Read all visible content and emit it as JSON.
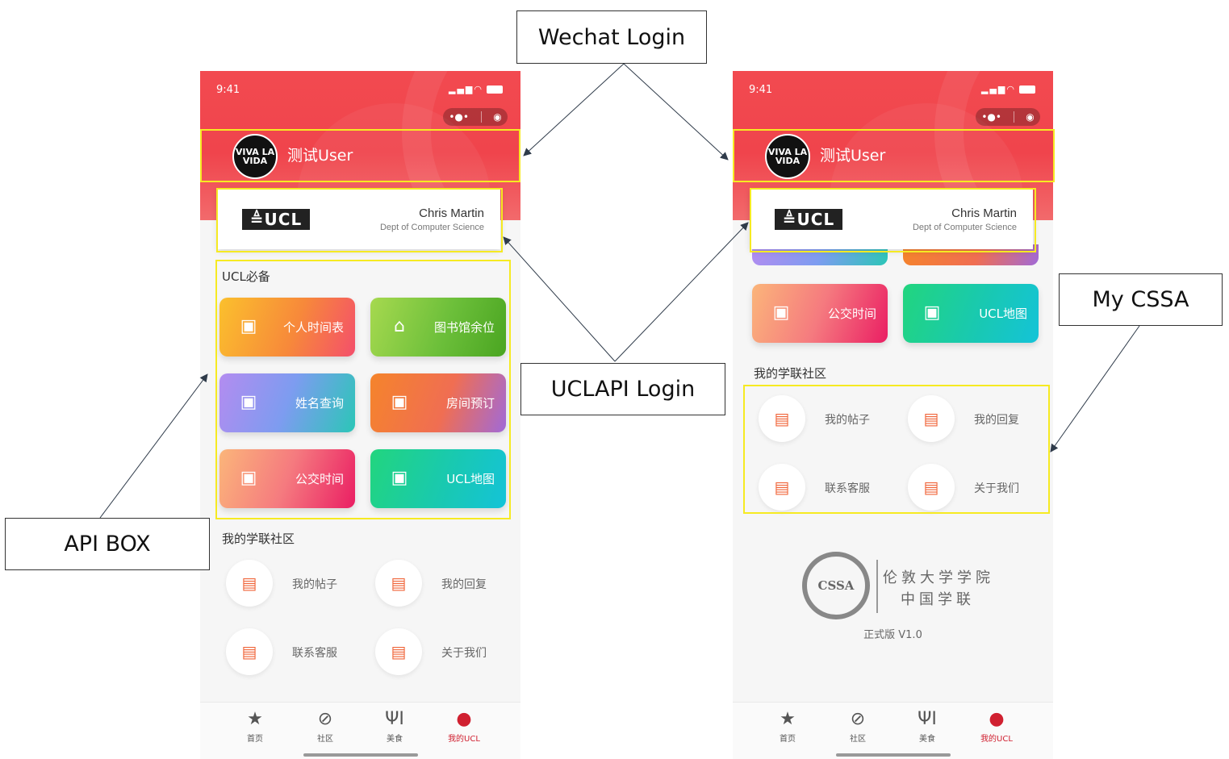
{
  "callouts": {
    "wechat_login": "Wechat Login",
    "uclapi_login": "UCLAPI Login",
    "api_box": "API BOX",
    "my_cssa": "My CSSA"
  },
  "status": {
    "time": "9:41"
  },
  "user": {
    "avatar_text": "VIVA LA VIDA",
    "name": "测试User"
  },
  "ucl_card": {
    "logo": "≜UCL",
    "name": "Chris Martin",
    "dept": "Dept of Computer Science"
  },
  "sections": {
    "ucl_essentials": "UCL必备",
    "community": "我的学联社区"
  },
  "tiles": [
    {
      "label": "个人时间表",
      "icon": "calendar-icon"
    },
    {
      "label": "图书馆余位",
      "icon": "library-icon"
    },
    {
      "label": "姓名查询",
      "icon": "calendar-icon"
    },
    {
      "label": "房间预订",
      "icon": "calendar-icon"
    },
    {
      "label": "公交时间",
      "icon": "calendar-icon"
    },
    {
      "label": "UCL地图",
      "icon": "calendar-icon"
    }
  ],
  "community_items": [
    {
      "label": "我的帖子",
      "icon": "clipboard-icon"
    },
    {
      "label": "我的回复",
      "icon": "clipboard-icon"
    },
    {
      "label": "联系客服",
      "icon": "clipboard-icon"
    },
    {
      "label": "关于我们",
      "icon": "clipboard-icon"
    }
  ],
  "tabbar": [
    {
      "label": "首页",
      "icon": "star-icon"
    },
    {
      "label": "社区",
      "icon": "compass-icon"
    },
    {
      "label": "美食",
      "icon": "fork-knife-icon"
    },
    {
      "label": "我的UCL",
      "icon": "user-icon"
    }
  ],
  "cssa": {
    "logo_text": "CSSA",
    "line1": "伦敦大学学院",
    "line2": "中国学联",
    "version": "正式版 V1.0"
  },
  "colors": {
    "header_red": "#f0444c",
    "highlight": "#f6ea22",
    "active_tab": "#d02030"
  }
}
